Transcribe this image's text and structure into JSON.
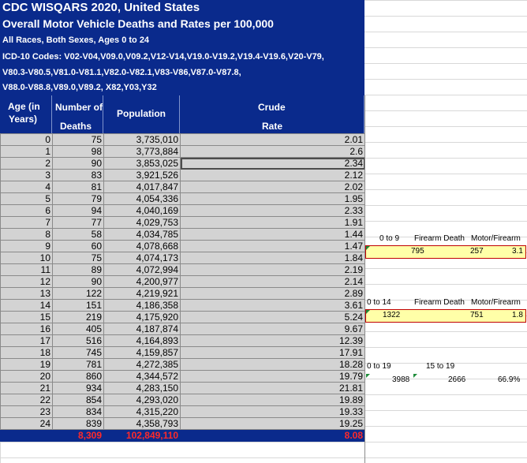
{
  "header": {
    "line1": "CDC WISQARS   2020, United States",
    "line2": "Overall Motor Vehicle Deaths and Rates per 100,000",
    "line3": "All Races, Both Sexes, Ages 0 to 24",
    "line4": "ICD-10 Codes: V02-V04,V09.0,V09.2,V12-V14,V19.0-V19.2,V19.4-V19.6,V20-V79,",
    "line5": "V80.3-V80.5,V81.0-V81.1,V82.0-V82.1,V83-V86,V87.0-V87.8,",
    "line6": "V88.0-V88.8,V89.0,V89.2, X82,Y03,Y32"
  },
  "columns": {
    "age_line1": "Age (in",
    "age_line2": "Years)",
    "deaths_line1": "Number of",
    "deaths_line2": "Deaths",
    "population": "Population",
    "rate_line1": "Crude",
    "rate_line2": "Rate"
  },
  "rows": [
    {
      "age": "0",
      "deaths": "75",
      "population": "3,735,010",
      "rate": "2.01"
    },
    {
      "age": "1",
      "deaths": "98",
      "population": "3,773,884",
      "rate": "2.6"
    },
    {
      "age": "2",
      "deaths": "90",
      "population": "3,853,025",
      "rate": "2.34"
    },
    {
      "age": "3",
      "deaths": "83",
      "population": "3,921,526",
      "rate": "2.12"
    },
    {
      "age": "4",
      "deaths": "81",
      "population": "4,017,847",
      "rate": "2.02"
    },
    {
      "age": "5",
      "deaths": "79",
      "population": "4,054,336",
      "rate": "1.95"
    },
    {
      "age": "6",
      "deaths": "94",
      "population": "4,040,169",
      "rate": "2.33"
    },
    {
      "age": "7",
      "deaths": "77",
      "population": "4,029,753",
      "rate": "1.91"
    },
    {
      "age": "8",
      "deaths": "58",
      "population": "4,034,785",
      "rate": "1.44"
    },
    {
      "age": "9",
      "deaths": "60",
      "population": "4,078,668",
      "rate": "1.47"
    },
    {
      "age": "10",
      "deaths": "75",
      "population": "4,074,173",
      "rate": "1.84"
    },
    {
      "age": "11",
      "deaths": "89",
      "population": "4,072,994",
      "rate": "2.19"
    },
    {
      "age": "12",
      "deaths": "90",
      "population": "4,200,977",
      "rate": "2.14"
    },
    {
      "age": "13",
      "deaths": "122",
      "population": "4,219,921",
      "rate": "2.89"
    },
    {
      "age": "14",
      "deaths": "151",
      "population": "4,186,358",
      "rate": "3.61"
    },
    {
      "age": "15",
      "deaths": "219",
      "population": "4,175,920",
      "rate": "5.24"
    },
    {
      "age": "16",
      "deaths": "405",
      "population": "4,187,874",
      "rate": "9.67"
    },
    {
      "age": "17",
      "deaths": "516",
      "population": "4,164,893",
      "rate": "12.39"
    },
    {
      "age": "18",
      "deaths": "745",
      "population": "4,159,857",
      "rate": "17.91"
    },
    {
      "age": "19",
      "deaths": "781",
      "population": "4,272,385",
      "rate": "18.28"
    },
    {
      "age": "20",
      "deaths": "860",
      "population": "4,344,572",
      "rate": "19.79"
    },
    {
      "age": "21",
      "deaths": "934",
      "population": "4,283,150",
      "rate": "21.81"
    },
    {
      "age": "22",
      "deaths": "854",
      "population": "4,293,020",
      "rate": "19.89"
    },
    {
      "age": "23",
      "deaths": "834",
      "population": "4,315,220",
      "rate": "19.33"
    },
    {
      "age": "24",
      "deaths": "839",
      "population": "4,358,793",
      "rate": "19.25"
    }
  ],
  "totals": {
    "deaths": "8,309",
    "population": "102,849,110",
    "rate": "8.08"
  },
  "side": {
    "b1": {
      "range": "0 to 9",
      "h1": "Firearm Death",
      "h2": "Motor/Firearm",
      "v1": "795",
      "v2": "257",
      "v3": "3.1"
    },
    "b2": {
      "range": "0 to 14",
      "h1": "Firearm Death",
      "h2": "Motor/Firearm",
      "v1": "1322",
      "v2": "751",
      "v3": "1.8"
    },
    "b3": {
      "range": "0 to 19",
      "h1": "15 to 19",
      "v1": "3988",
      "v2": "2666",
      "v3": "66.9%"
    }
  },
  "colors": {
    "header_bg": "#0a2a8c",
    "total_text": "#ff2a2a",
    "cell_bg": "#d3d3d3",
    "highlight_bg": "#ffffa8",
    "highlight_border": "#c00000"
  }
}
